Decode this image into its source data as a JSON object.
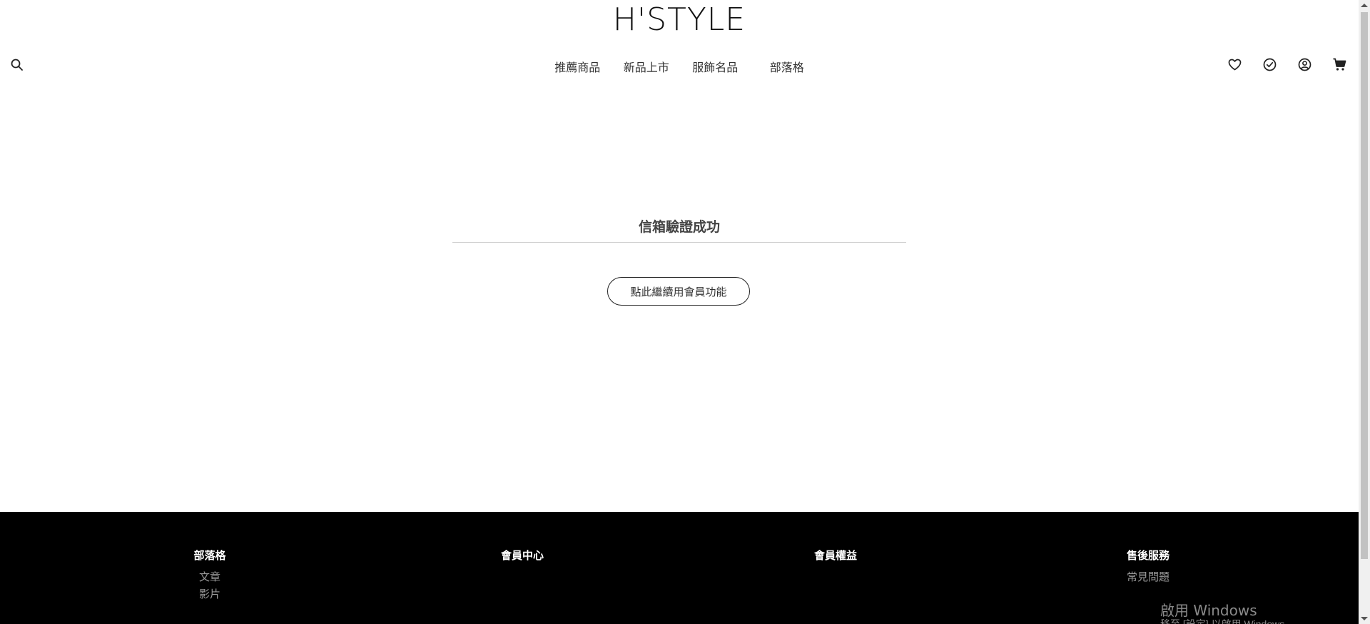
{
  "header": {
    "logo": "H'STYLE",
    "search_icon": "search-icon",
    "nav": [
      "推薦商品",
      "新品上市",
      "服飾名品",
      "部落格"
    ],
    "icons": [
      "heart-icon",
      "check-circle-icon",
      "user-icon",
      "cart-icon"
    ]
  },
  "main": {
    "title": "信箱驗證成功",
    "button_label": "點此繼續用會員功能"
  },
  "footer": {
    "columns": [
      {
        "heading": "部落格",
        "links": [
          "文章",
          "影片"
        ]
      },
      {
        "heading": "會員中心",
        "links": []
      },
      {
        "heading": "會員權益",
        "links": []
      },
      {
        "heading": "售後服務",
        "links": [
          "常見問題"
        ]
      }
    ],
    "background_color": "#000000"
  },
  "watermark": {
    "line1": "啟用 Windows",
    "line2": "移至 [設定] 以啟用 Windows。"
  }
}
